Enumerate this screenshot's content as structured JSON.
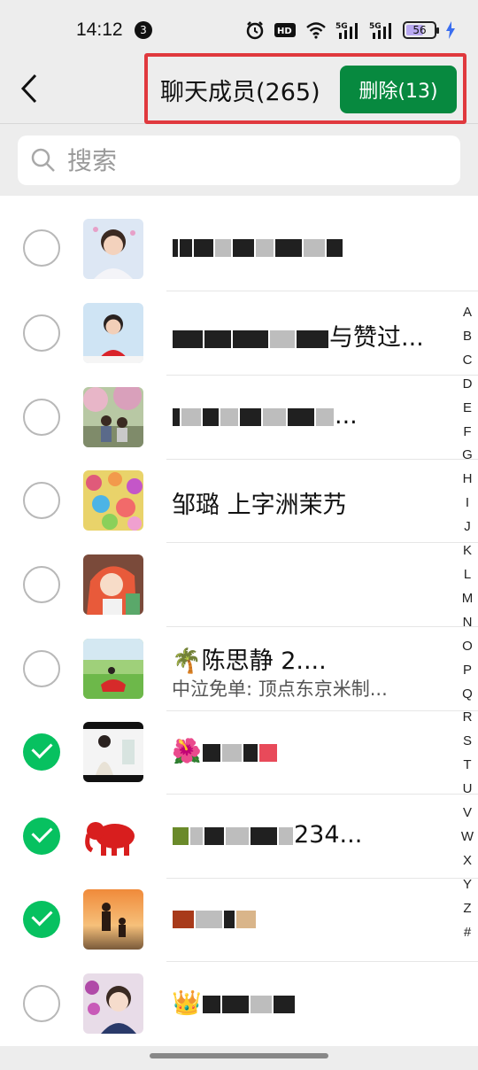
{
  "status_bar": {
    "time": "14:12",
    "notification_count": "3",
    "battery": "56",
    "network_1": "5G",
    "network_2": "5G"
  },
  "header": {
    "title": "聊天成员(265)",
    "delete_label": "删除(13)"
  },
  "search": {
    "placeholder": "搜索"
  },
  "members": [
    {
      "checked": false,
      "name": "",
      "sub": ""
    },
    {
      "checked": false,
      "name": "与赞过...",
      "sub": ""
    },
    {
      "checked": false,
      "name": "...",
      "sub": ""
    },
    {
      "checked": false,
      "name": "邹璐 上字洲茉艿",
      "sub": ""
    },
    {
      "checked": false,
      "name": "",
      "sub": ""
    },
    {
      "checked": false,
      "name": "陈思静 2....",
      "sub": "中泣免单: 顶点东京米制..."
    },
    {
      "checked": true,
      "name": "",
      "sub": ""
    },
    {
      "checked": true,
      "name": "234...",
      "sub": ""
    },
    {
      "checked": true,
      "name": "",
      "sub": ""
    },
    {
      "checked": false,
      "name": "",
      "sub": ""
    }
  ],
  "index_letters": [
    "A",
    "B",
    "C",
    "D",
    "E",
    "F",
    "G",
    "H",
    "I",
    "J",
    "K",
    "L",
    "M",
    "N",
    "O",
    "P",
    "Q",
    "R",
    "S",
    "T",
    "U",
    "V",
    "W",
    "X",
    "Y",
    "Z",
    "#"
  ],
  "colors": {
    "accent_green": "#07c160",
    "delete_button": "#07893f",
    "highlight_border": "#e0393e"
  }
}
